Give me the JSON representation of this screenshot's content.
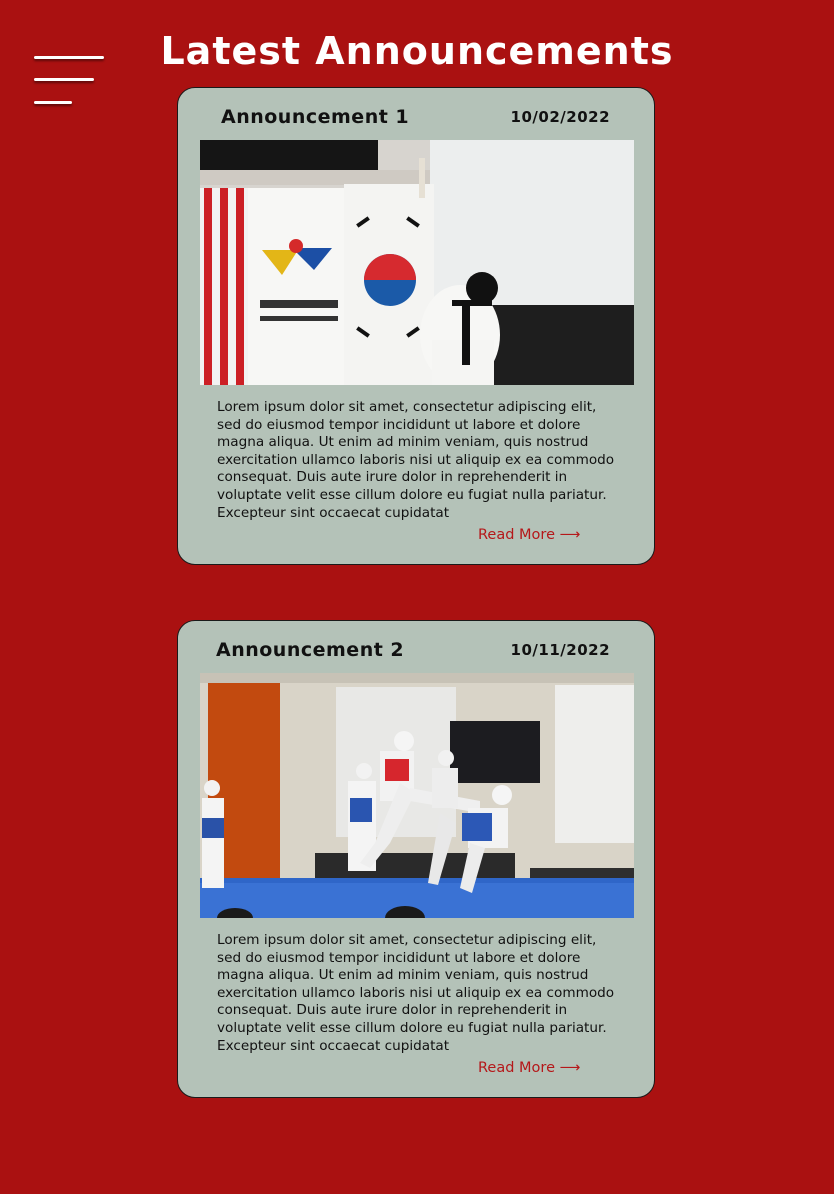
{
  "page": {
    "title": "Latest Announcements"
  },
  "menu": {
    "icon": "hamburger-menu-icon"
  },
  "announcements": [
    {
      "title": "Announcement 1",
      "date": "10/02/2022",
      "image_description": "Taekwondo athlete bowing in front of American, World Taekwondo and Korean flags",
      "body": "Lorem ipsum dolor sit amet, consectetur adipiscing elit, sed do eiusmod tempor incididunt ut labore et dolore magna aliqua. Ut enim ad minim veniam, quis nostrud exercitation ullamco laboris nisi ut aliquip ex ea commodo consequat. Duis aute irure dolor in reprehenderit in voluptate velit esse cillum dolore eu fugiat nulla pariatur. Excepteur sint occaecat cupidatat",
      "read_more": "Read More ⟶"
    },
    {
      "title": "Announcement 2",
      "date": "10/11/2022",
      "image_description": "Taekwondo sparring match with kicks on a blue mat",
      "body": "Lorem ipsum dolor sit amet, consectetur adipiscing elit, sed do eiusmod tempor incididunt ut labore et dolore magna aliqua. Ut enim ad minim veniam, quis nostrud exercitation ullamco laboris nisi ut aliquip ex ea commodo consequat. Duis aute irure dolor in reprehenderit in voluptate velit esse cillum dolore eu fugiat nulla pariatur. Excepteur sint occaecat cupidatat",
      "read_more": "Read More ⟶"
    }
  ],
  "colors": {
    "background": "#aa1111",
    "card": "#b4c2b8",
    "link": "#b5181a"
  }
}
